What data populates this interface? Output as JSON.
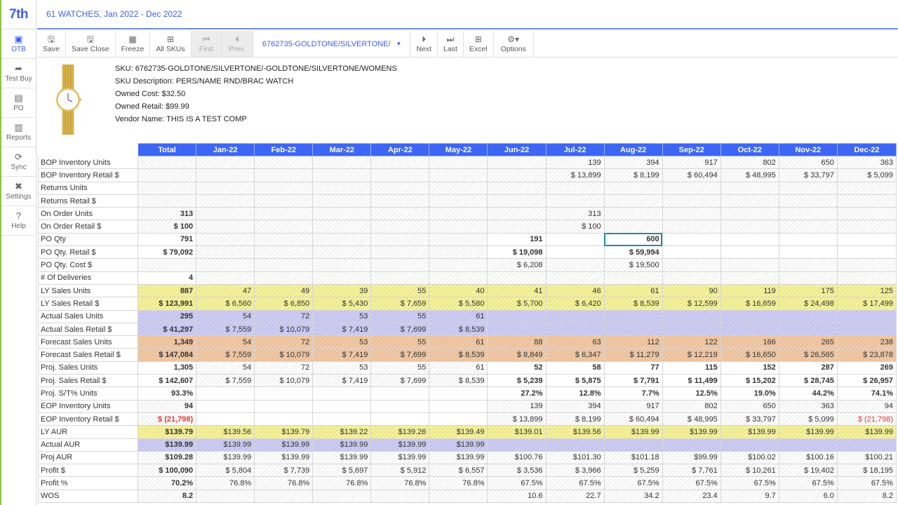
{
  "app": {
    "logo": "7th",
    "title": "61 WATCHES, Jan 2022 - Dec 2022"
  },
  "sidebar": {
    "items": [
      {
        "label": "OTB",
        "icon": "calendar-dollar-icon",
        "glyph": "▣",
        "active": true
      },
      {
        "label": "Test Buy",
        "icon": "share-arrow-icon",
        "glyph": "➦",
        "active": false
      },
      {
        "label": "PO",
        "icon": "clipboard-icon",
        "glyph": "▤",
        "active": false
      },
      {
        "label": "Reports",
        "icon": "bar-chart-icon",
        "glyph": "▥",
        "active": false
      },
      {
        "label": "Sync",
        "icon": "refresh-icon",
        "glyph": "⟳",
        "active": false
      },
      {
        "label": "Settings",
        "icon": "tools-icon",
        "glyph": "✖",
        "active": false
      },
      {
        "label": "Help",
        "icon": "help-icon",
        "glyph": "?",
        "active": false
      }
    ]
  },
  "toolbar": {
    "save": "Save",
    "save_close": "Save Close",
    "freeze": "Freeze",
    "all_skus": "All SKUs",
    "first": "First",
    "prev": "Prev.",
    "sku_selected": "6762735-GOLDTONE/SILVERTONE/",
    "next": "Next",
    "last": "Last",
    "excel": "Excel",
    "options": "Options"
  },
  "product": {
    "sku": "SKU: 6762735-GOLDTONE/SILVERTONE/-GOLDTONE/SILVERTONE/WOMENS",
    "description": "SKU Description: PERS/NAME RND/BRAC WATCH",
    "owned_cost": "Owned Cost: $32.50",
    "owned_retail": "Owned Retail: $99.99",
    "vendor": "Vendor Name: THIS IS A TEST COMP"
  },
  "colors": {
    "accent": "#3d66f5",
    "yellow": "#f6f39a",
    "purple": "#cfcdf5",
    "orange": "#f3c9a5",
    "negative": "#e03b3b",
    "selection": "#1f8cab"
  },
  "grid": {
    "columns": [
      "Total",
      "Jan-22",
      "Feb-22",
      "Mar-22",
      "Apr-22",
      "May-22",
      "Jun-22",
      "Jul-22",
      "Aug-22",
      "Sep-22",
      "Oct-22",
      "Nov-22",
      "Dec-22"
    ],
    "rows": [
      {
        "label": "BOP Inventory Units",
        "cells": [
          "",
          "",
          "",
          "",
          "",
          "",
          "",
          "139",
          "394",
          "917",
          "802",
          "650",
          "363"
        ]
      },
      {
        "label": "BOP Inventory Retail $",
        "cells": [
          "",
          "",
          "",
          "",
          "",
          "",
          "",
          "$ 13,899",
          "$ 8,199",
          "$ 60,494",
          "$ 48,995",
          "$ 33,797",
          "$ 5,099"
        ]
      },
      {
        "label": "Returns Units",
        "cells": [
          "",
          "",
          "",
          "",
          "",
          "",
          "",
          "",
          "",
          "",
          "",
          "",
          ""
        ]
      },
      {
        "label": "Returns Retail $",
        "cells": [
          "",
          "",
          "",
          "",
          "",
          "",
          "",
          "",
          "",
          "",
          "",
          "",
          ""
        ]
      },
      {
        "label": "On Order Units",
        "cells": [
          "313",
          "",
          "",
          "",
          "",
          "",
          "",
          "313",
          "",
          "",
          "",
          "",
          ""
        ]
      },
      {
        "label": "On Order Retail $",
        "cells": [
          "$ 100",
          "",
          "",
          "",
          "",
          "",
          "",
          "$ 100",
          "",
          "",
          "",
          "",
          ""
        ]
      },
      {
        "label": "PO Qty",
        "cells": [
          "791",
          "",
          "",
          "",
          "",
          "",
          "191",
          "",
          "600",
          "",
          "",
          "",
          ""
        ]
      },
      {
        "label": "PO Qty. Retail $",
        "cells": [
          "$ 79,092",
          "",
          "",
          "",
          "",
          "",
          "$ 19,098",
          "",
          "$ 59,994",
          "",
          "",
          "",
          ""
        ]
      },
      {
        "label": "PO Qty. Cost $",
        "cells": [
          "",
          "",
          "",
          "",
          "",
          "",
          "$ 6,208",
          "",
          "$ 19,500",
          "",
          "",
          "",
          ""
        ]
      },
      {
        "label": "# Of Deliveries",
        "cells": [
          "4",
          "",
          "",
          "",
          "",
          "",
          "",
          "",
          "",
          "",
          "",
          "",
          ""
        ]
      },
      {
        "label": "LY Sales Units",
        "cells": [
          "887",
          "47",
          "49",
          "39",
          "55",
          "40",
          "41",
          "46",
          "61",
          "90",
          "119",
          "175",
          "125"
        ]
      },
      {
        "label": "LY Sales Retail $",
        "cells": [
          "$ 123,991",
          "$ 6,560",
          "$ 6,850",
          "$ 5,430",
          "$ 7,659",
          "$ 5,580",
          "$ 5,700",
          "$ 6,420",
          "$ 8,539",
          "$ 12,599",
          "$ 16,659",
          "$ 24,498",
          "$ 17,499"
        ]
      },
      {
        "label": "Actual Sales Units",
        "cells": [
          "295",
          "54",
          "72",
          "53",
          "55",
          "61",
          "",
          "",
          "",
          "",
          "",
          "",
          ""
        ]
      },
      {
        "label": "Actual Sales Retail $",
        "cells": [
          "$ 41,297",
          "$ 7,559",
          "$ 10,079",
          "$ 7,419",
          "$ 7,699",
          "$ 8,539",
          "",
          "",
          "",
          "",
          "",
          "",
          ""
        ]
      },
      {
        "label": "Forecast Sales Units",
        "cells": [
          "1,349",
          "54",
          "72",
          "53",
          "55",
          "61",
          "88",
          "63",
          "112",
          "122",
          "166",
          "265",
          "238"
        ]
      },
      {
        "label": "Forecast Sales Retail $",
        "cells": [
          "$ 147,084",
          "$ 7,559",
          "$ 10,079",
          "$ 7,419",
          "$ 7,699",
          "$ 8,539",
          "$ 8,849",
          "$ 6,347",
          "$ 11,279",
          "$ 12,219",
          "$ 16,650",
          "$ 26,565",
          "$ 23,878"
        ]
      },
      {
        "label": "Proj. Sales Units",
        "cells": [
          "1,305",
          "54",
          "72",
          "53",
          "55",
          "61",
          "52",
          "58",
          "77",
          "115",
          "152",
          "287",
          "269"
        ]
      },
      {
        "label": "Proj. Sales Retail $",
        "cells": [
          "$ 142,607",
          "$ 7,559",
          "$ 10,079",
          "$ 7,419",
          "$ 7,699",
          "$ 8,539",
          "$ 5,239",
          "$ 5,875",
          "$ 7,791",
          "$ 11,499",
          "$ 15,202",
          "$ 28,745",
          "$ 26,957"
        ]
      },
      {
        "label": "Proj.  S/T% Units",
        "cells": [
          "93.3%",
          "",
          "",
          "",
          "",
          "",
          "27.2%",
          "12.8%",
          "7.7%",
          "12.5%",
          "19.0%",
          "44.2%",
          "74.1%"
        ]
      },
      {
        "label": "EOP Inventory Units",
        "cells": [
          "94",
          "",
          "",
          "",
          "",
          "",
          "139",
          "394",
          "917",
          "802",
          "650",
          "363",
          "94"
        ]
      },
      {
        "label": "EOP Inventory Retail $",
        "cells": [
          "$ (21,798)",
          "",
          "",
          "",
          "",
          "",
          "$ 13,899",
          "$ 8,199",
          "$ 60,494",
          "$ 48,995",
          "$ 33,797",
          "$ 5,099",
          "$ (21,798)"
        ]
      },
      {
        "label": "LY AUR",
        "cells": [
          "$139.79",
          "$139.56",
          "$139.79",
          "$139.22",
          "$139.26",
          "$139.49",
          "$139.01",
          "$139.56",
          "$139.99",
          "$139.99",
          "$139.99",
          "$139.99",
          "$139.99"
        ]
      },
      {
        "label": "Actual AUR",
        "cells": [
          "$139.99",
          "$139.99",
          "$139.99",
          "$139.99",
          "$139.99",
          "$139.99",
          "",
          "",
          "",
          "",
          "",
          "",
          ""
        ]
      },
      {
        "label": "Proj AUR",
        "cells": [
          "$109.28",
          "$139.99",
          "$139.99",
          "$139.99",
          "$139.99",
          "$139.99",
          "$100.76",
          "$101.30",
          "$101.18",
          "$99.99",
          "$100.02",
          "$100.16",
          "$100.21"
        ]
      },
      {
        "label": "Profit $",
        "cells": [
          "$ 100,090",
          "$ 5,804",
          "$ 7,739",
          "$ 5,697",
          "$ 5,912",
          "$ 6,557",
          "$ 3,536",
          "$ 3,966",
          "$ 5,259",
          "$ 7,761",
          "$ 10,261",
          "$ 19,402",
          "$ 18,195"
        ]
      },
      {
        "label": "Profit %",
        "cells": [
          "70.2%",
          "76.8%",
          "76.8%",
          "76.8%",
          "76.8%",
          "76.8%",
          "67.5%",
          "67.5%",
          "67.5%",
          "67.5%",
          "67.5%",
          "67.5%",
          "67.5%"
        ]
      },
      {
        "label": "WOS",
        "cells": [
          "8.2",
          "",
          "",
          "",
          "",
          "",
          "10.6",
          "22.7",
          "34.2",
          "23.4",
          "9.7",
          "6.0",
          "8.2"
        ]
      }
    ]
  }
}
